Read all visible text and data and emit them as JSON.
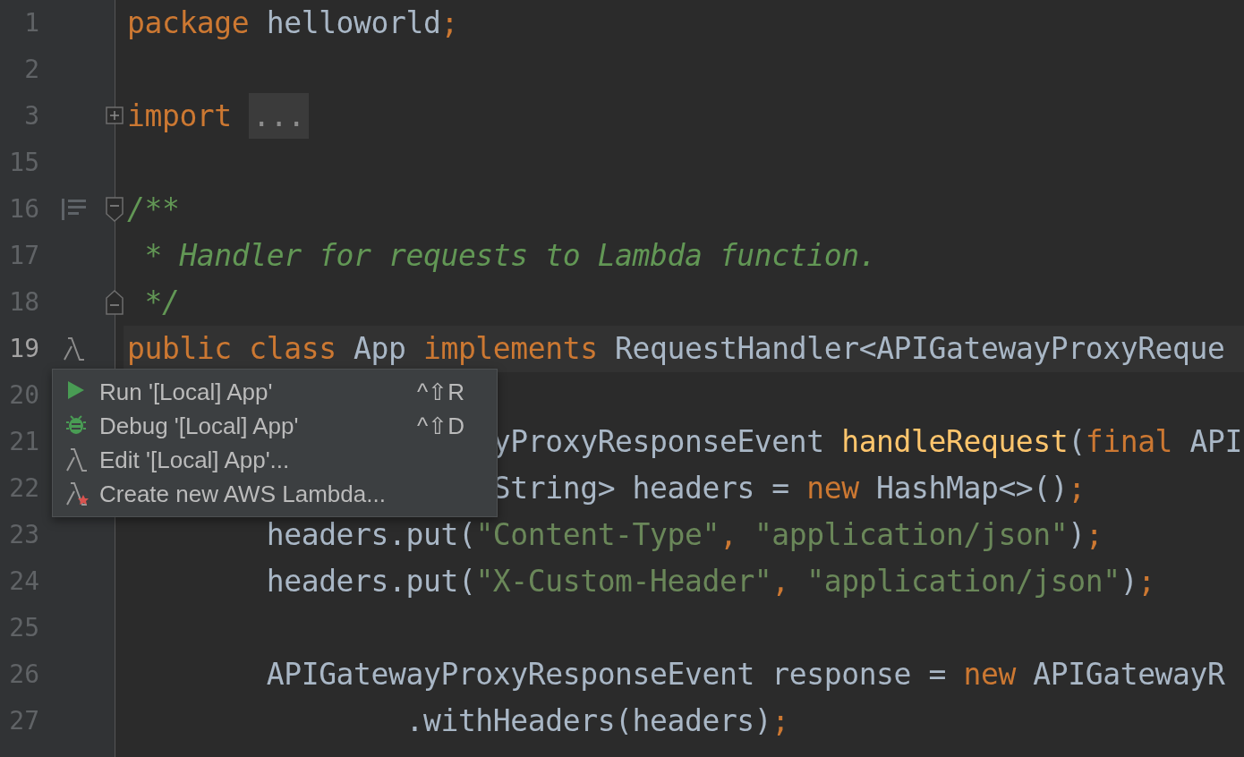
{
  "editor": {
    "lines": [
      {
        "number": "1",
        "tokens": [
          {
            "kind": "keyword",
            "text": "package"
          },
          {
            "kind": "plain",
            "text": " helloworld"
          },
          {
            "kind": "keyword",
            "text": ";"
          }
        ]
      },
      {
        "number": "2"
      },
      {
        "number": "3",
        "fold": {
          "kind": "collapsed"
        },
        "tokens": [
          {
            "kind": "keyword",
            "text": "import "
          },
          {
            "kind": "placeholder",
            "text": "..."
          }
        ]
      },
      {
        "number": "15"
      },
      {
        "number": "16",
        "fold": {
          "kind": "start"
        },
        "gutter_icon": {
          "kind": "doc"
        },
        "tokens": [
          {
            "kind": "comment",
            "text": "/**"
          }
        ]
      },
      {
        "number": "17",
        "tokens": [
          {
            "kind": "comment",
            "text": " * Handler for requests to Lambda function."
          }
        ]
      },
      {
        "number": "18",
        "fold": {
          "kind": "end"
        },
        "tokens": [
          {
            "kind": "comment",
            "text": " */"
          }
        ]
      },
      {
        "number": "19",
        "current": true,
        "gutter_icon": {
          "kind": "lambda"
        },
        "tokens": [
          {
            "kind": "keyword",
            "text": "public class"
          },
          {
            "kind": "plain",
            "text": " App "
          },
          {
            "kind": "keyword",
            "text": "implements"
          },
          {
            "kind": "plain",
            "text": " RequestHandler<APIGatewayProxyReque"
          }
        ]
      },
      {
        "number": "20"
      },
      {
        "number": "21",
        "tokens": [
          {
            "kind": "plain",
            "text": "                     yProxyResponseEvent "
          },
          {
            "kind": "method",
            "text": "handleRequest"
          },
          {
            "kind": "plain",
            "text": "("
          },
          {
            "kind": "keyword",
            "text": "final"
          },
          {
            "kind": "plain",
            "text": " API"
          }
        ]
      },
      {
        "number": "22",
        "tokens": [
          {
            "kind": "plain",
            "text": "                     String> headers = "
          },
          {
            "kind": "keyword",
            "text": "new"
          },
          {
            "kind": "plain",
            "text": " HashMap<>()"
          },
          {
            "kind": "keyword",
            "text": ";"
          }
        ]
      },
      {
        "number": "23",
        "tokens": [
          {
            "kind": "plain",
            "text": "        headers.put("
          },
          {
            "kind": "string",
            "text": "\"Content-Type\""
          },
          {
            "kind": "keyword",
            "text": ", "
          },
          {
            "kind": "string",
            "text": "\"application/json\""
          },
          {
            "kind": "plain",
            "text": ")"
          },
          {
            "kind": "keyword",
            "text": ";"
          }
        ]
      },
      {
        "number": "24",
        "tokens": [
          {
            "kind": "plain",
            "text": "        headers.put("
          },
          {
            "kind": "string",
            "text": "\"X-Custom-Header\""
          },
          {
            "kind": "keyword",
            "text": ", "
          },
          {
            "kind": "string",
            "text": "\"application/json\""
          },
          {
            "kind": "plain",
            "text": ")"
          },
          {
            "kind": "keyword",
            "text": ";"
          }
        ]
      },
      {
        "number": "25"
      },
      {
        "number": "26",
        "tokens": [
          {
            "kind": "plain",
            "text": "        APIGatewayProxyResponseEvent response = "
          },
          {
            "kind": "keyword",
            "text": "new"
          },
          {
            "kind": "plain",
            "text": " APIGatewayR"
          }
        ]
      },
      {
        "number": "27",
        "tokens": [
          {
            "kind": "plain",
            "text": "                .withHeaders(headers)"
          },
          {
            "kind": "keyword",
            "text": ";"
          }
        ]
      }
    ]
  },
  "popup_menu": {
    "items": [
      {
        "kind": "run",
        "label": "Run '[Local] App'",
        "shortcut": "^⇧R"
      },
      {
        "kind": "debug",
        "label": "Debug '[Local] App'",
        "shortcut": "^⇧D"
      },
      {
        "kind": "edit",
        "label": "Edit '[Local] App'..."
      },
      {
        "kind": "create",
        "label": "Create new AWS Lambda..."
      }
    ]
  }
}
